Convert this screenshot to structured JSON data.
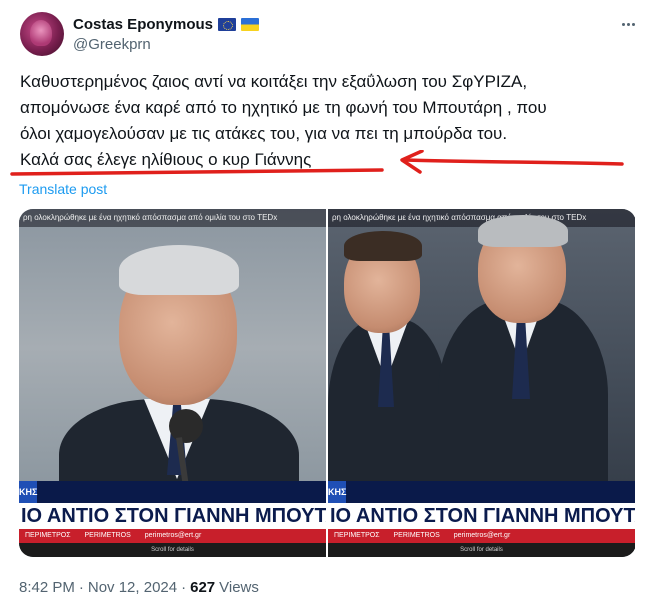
{
  "author": {
    "display_name": "Costas Eponymous",
    "handle": "@Greekprn",
    "flags": [
      "eu-flag-icon",
      "ukraine-flag-icon"
    ]
  },
  "tweet": {
    "lines": [
      "Καθυστερημένος ζαιος αντί να κοιτάξει την εξαΰλωση του ΣφΥΡΙΖΑ,",
      "απομόνωσε ένα καρέ από το ηχητικό με τη φωνή του Μπουτάρη , που",
      "όλοι χαμογελούσαν με τις ατάκες του,  για να πει τη μπούρδα του.",
      "Καλά σας έλεγε ηλίθιους ο κυρ Γιάννης"
    ],
    "translate_label": "Translate post"
  },
  "media": {
    "left": {
      "top_ticker": "ρη ολοκληρώθηκε με ένα ηχητικό απόσπασμα από ομιλία του στο TEDx",
      "tag": "ΚΗΣ",
      "headline": "ΙΟ ΑΝΤΙΟ ΣΤΟΝ ΓΙΑΝΝΗ ΜΠΟΥΤΑ",
      "bottom_items": [
        "ΠΕΡΙΜΕΤΡΟΣ",
        "PERIMETROS",
        "perimetros@ert.gr"
      ],
      "scroll_hint": "Scroll for details"
    },
    "right": {
      "top_ticker": "ρη ολοκληρώθηκε με ένα ηχητικό απόσπασμα από ομιλία του στο TEDx",
      "tag": "ΚΗΣ",
      "headline": "ΙΟ ΑΝΤΙΟ ΣΤΟΝ ΓΙΑΝΝΗ ΜΠΟΥΤΑ",
      "bottom_items": [
        "ΠΕΡΙΜΕΤΡΟΣ",
        "PERIMETROS",
        "perimetros@ert.gr"
      ],
      "scroll_hint": "Scroll for details"
    }
  },
  "footer": {
    "time": "8:42 PM",
    "separator": "·",
    "date": "Nov 12, 2024",
    "views_count": "627",
    "views_label": "Views"
  },
  "colors": {
    "text_primary": "#0f1419",
    "text_secondary": "#536471",
    "link": "#1d9bf0",
    "annotation_red": "#e0201c",
    "news_blue": "#0a1a4a",
    "news_red": "#c81f2b"
  }
}
